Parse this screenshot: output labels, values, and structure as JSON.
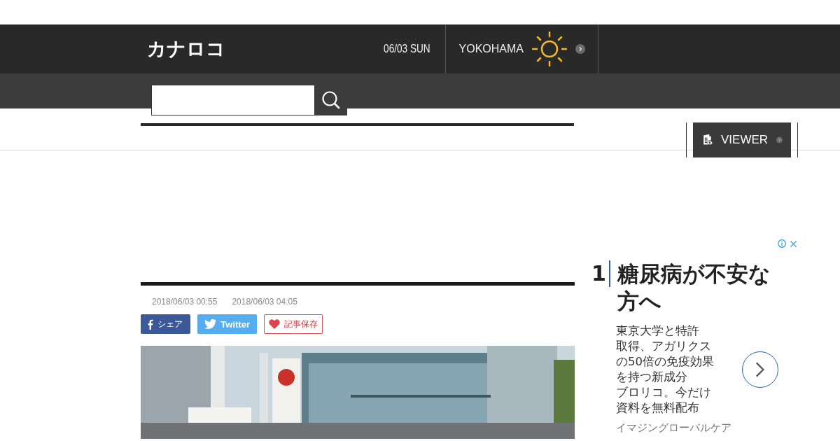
{
  "header": {
    "logo": "カナロコ",
    "date": "06/03 SUN",
    "city": "YOKOHAMA"
  },
  "viewer_button": {
    "label": "VIEWER"
  },
  "article": {
    "published": "2018/06/03 00:55",
    "updated": "2018/06/03 04:05",
    "share_buttons": [
      {
        "kind": "facebook",
        "label": "シェア"
      },
      {
        "kind": "twitter",
        "label": "Twitter"
      },
      {
        "kind": "save",
        "label": "記事保存"
      }
    ]
  },
  "ad": {
    "rank": "1",
    "headline": "糖尿病が不安な方へ",
    "body_lines": [
      "東京大学と特許",
      "取得、アガリクス",
      "の50倍の免疫効果",
      "を持つ新成分",
      "ブロリコ。今だけ",
      "資料を無料配布"
    ],
    "advertiser": "イマジングローバルケア"
  }
}
